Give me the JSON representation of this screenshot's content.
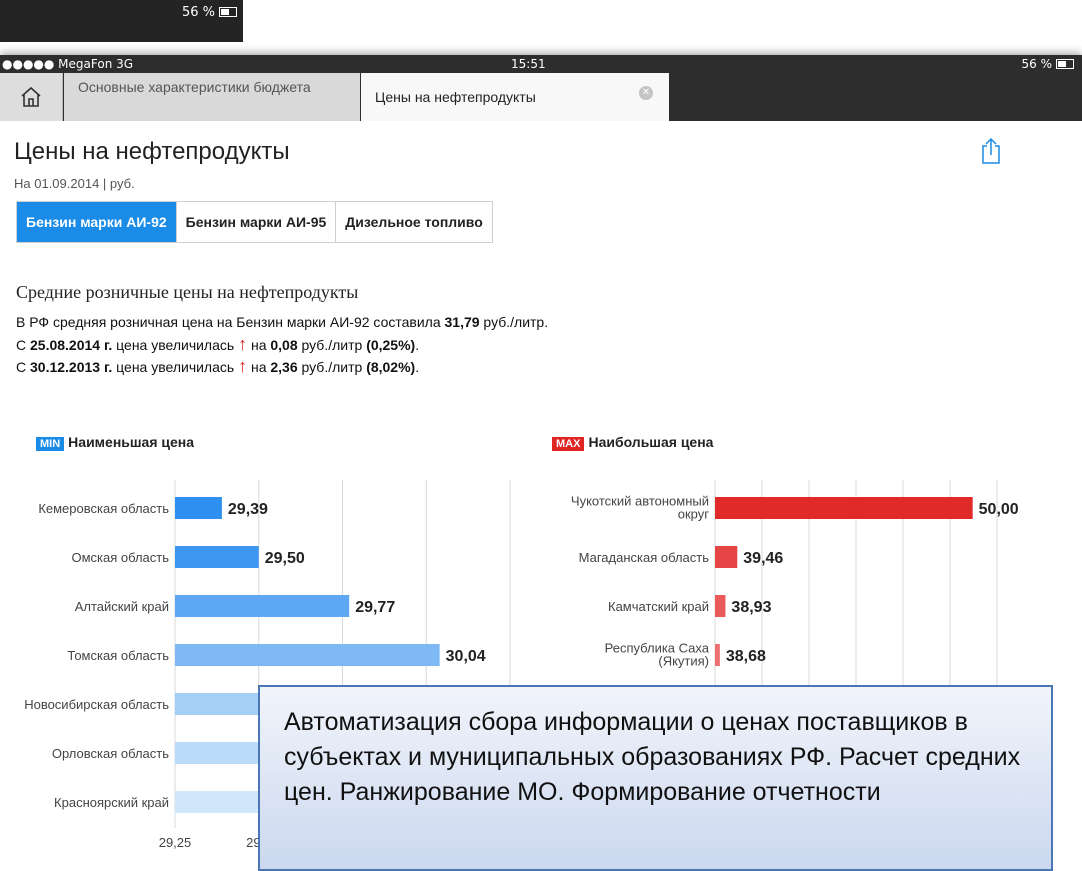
{
  "background_screen": {
    "battery": "56 %"
  },
  "status_bar": {
    "carrier": "●●●●● MegaFon  3G",
    "time": "15:51",
    "battery": "56 %"
  },
  "tabs": [
    {
      "label": "Основные характеристики бюджета",
      "active": false
    },
    {
      "label": "Цены на нефтепродукты",
      "active": true
    }
  ],
  "page": {
    "title": "Цены на нефтепродукты",
    "subtitle": "На 01.09.2014  |  руб.",
    "segments": [
      "Бензин марки АИ-92",
      "Бензин марки АИ-95",
      "Дизельное топливо"
    ],
    "selected_segment": 0,
    "section_title": "Средние розничные цены на нефтепродукты",
    "info": {
      "line1_pre": "В РФ средняя розничная цена на Бензин марки АИ-92 составила ",
      "line1_value": "31,79",
      "line1_unit": " руб./литр.",
      "line2_pre": "С ",
      "line2_date": "25.08.2014 г.",
      "line2_mid": " цена увеличилась ",
      "line2_arrow": "↑",
      "line2_on": " на ",
      "line2_value": "0,08",
      "line2_unit": " руб./литр ",
      "line2_pct": "(0,25%)",
      "line2_end": ".",
      "line3_pre": "С ",
      "line3_date": "30.12.2013 г.",
      "line3_mid": " цена увеличилась ",
      "line3_arrow": "↑",
      "line3_on": " на ",
      "line3_value": "2,36",
      "line3_unit": " руб./литр ",
      "line3_pct": "(8,02%)",
      "line3_end": "."
    },
    "min_legend": {
      "badge": "MIN",
      "label": "Наименьшая цена"
    },
    "max_legend": {
      "badge": "MAX",
      "label": "Наибольшая цена"
    }
  },
  "colors": {
    "accent": "#1a8be6",
    "up_arrow": "#e02020",
    "max_badge": "#e02424",
    "min_badge": "#1a8be6"
  },
  "chart_data": [
    {
      "type": "bar",
      "orientation": "horizontal",
      "title": "Наименьшая цена",
      "categories": [
        "Кемеровская область",
        "Омская область",
        "Алтайский край",
        "Томская область",
        "Новосибирская область",
        "Орловская область",
        "Красноярский край"
      ],
      "values": [
        29.39,
        29.5,
        29.77,
        30.04,
        30.1,
        30.12,
        30.14
      ],
      "value_labels": [
        "29,39",
        "29,50",
        "29,77",
        "30,04",
        "",
        "",
        ""
      ],
      "x_ticks": [
        "29,25",
        "29,5"
      ],
      "colors": [
        "#2f8ff0",
        "#3d97f1",
        "#5ea8f3",
        "#7eb9f5",
        "#a6cff8",
        "#bbdbfa",
        "#cfe6fb"
      ],
      "xlim": [
        29.25,
        30.25
      ]
    },
    {
      "type": "bar",
      "orientation": "horizontal",
      "title": "Наибольшая цена",
      "categories": [
        "Чукотский автономный округ",
        "Магаданская область",
        "Камчатский край",
        "Республика Саха (Якутия)"
      ],
      "category_lines": [
        [
          "Чукотский автономный",
          "округ"
        ],
        [
          "Магаданская область"
        ],
        [
          "Камчатский край"
        ],
        [
          "Республика Саха",
          "(Якутия)"
        ]
      ],
      "values": [
        50.0,
        39.46,
        38.93,
        38.68
      ],
      "value_labels": [
        "50,00",
        "39,46",
        "38,93",
        "38,68"
      ],
      "colors": [
        "#e02a2a",
        "#e64545",
        "#ea5a5a",
        "#ee6f6f"
      ],
      "xlim": [
        36,
        51
      ]
    }
  ],
  "note": "Автоматизация сбора информации о ценах поставщиков в субъектах и муниципальных образованиях РФ. Расчет средних цен. Ранжирование МО. Формирование отчетности"
}
